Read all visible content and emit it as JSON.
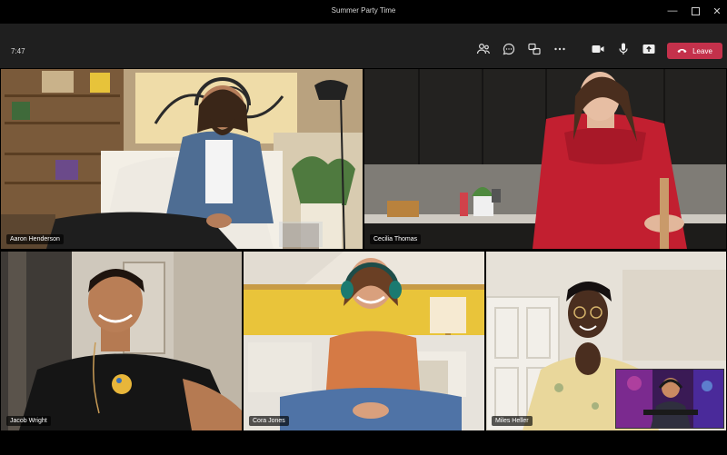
{
  "window": {
    "title": "Summer Party Time"
  },
  "toolbar": {
    "time": "7:47",
    "leave_label": "Leave"
  },
  "participants": [
    {
      "name": "Aaron Henderson"
    },
    {
      "name": "Cecilia Thomas"
    },
    {
      "name": "Jacob Wright"
    },
    {
      "name": "Cora Jones"
    },
    {
      "name": "Miles Heller"
    }
  ],
  "colors": {
    "leave": "#c4314b",
    "toolbar": "#1f1f1f",
    "background": "#000000"
  }
}
